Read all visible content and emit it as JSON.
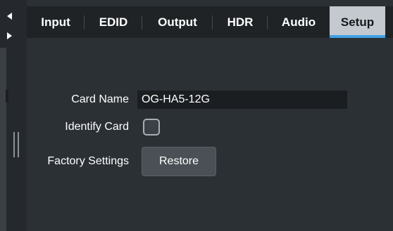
{
  "tabs": [
    {
      "label": "Input",
      "active": false
    },
    {
      "label": "EDID",
      "active": false
    },
    {
      "label": "Output",
      "active": false
    },
    {
      "label": "HDR",
      "active": false
    },
    {
      "label": "Audio",
      "active": false
    },
    {
      "label": "Setup",
      "active": true
    }
  ],
  "setup": {
    "card_name_label": "Card Name",
    "card_name_value": "OG-HA5-12G",
    "identify_card_label": "Identify Card",
    "identify_card_checked": false,
    "factory_settings_label": "Factory Settings",
    "restore_button_label": "Restore"
  },
  "colors": {
    "background": "#2b3035",
    "tab_bar": "#1f2326",
    "active_tab": "#c3c9cf",
    "active_accent": "#3fa0e3"
  },
  "icons": {
    "scroll_left": "triangle-left-icon",
    "scroll_right": "triangle-right-icon"
  }
}
